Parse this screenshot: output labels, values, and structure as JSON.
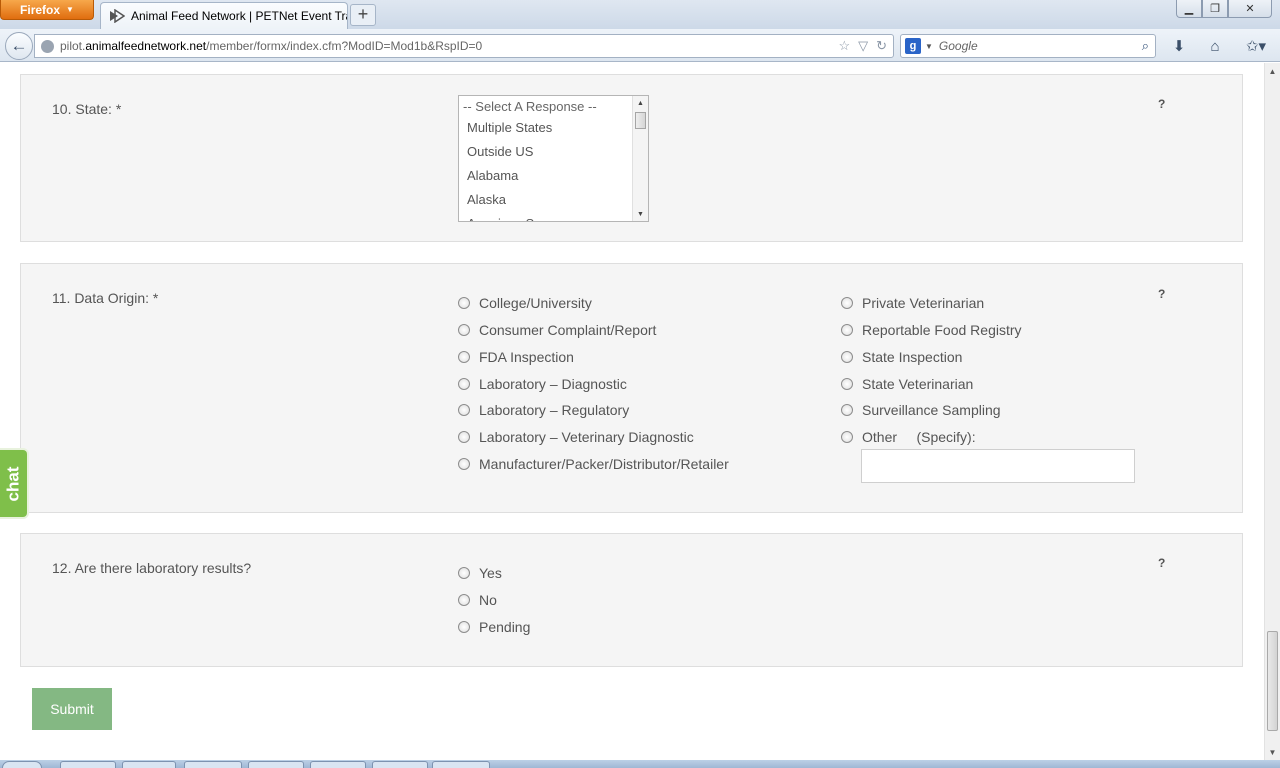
{
  "browser": {
    "app_button": "Firefox",
    "tab_title": "Animal Feed Network | PETNet Event Tra...",
    "url_prefix": "pilot.",
    "url_domain": "animalfeednetwork.net",
    "url_path": "/member/formx/index.cfm?ModID=Mod1b&RspID=0",
    "search_placeholder": "Google"
  },
  "form": {
    "q10": {
      "label": "10. State: *",
      "help": "?",
      "options": [
        "-- Select A Response --",
        "Multiple States",
        "Outside US",
        "Alabama",
        "Alaska",
        "American Samoa"
      ]
    },
    "q11": {
      "label": "11. Data Origin: *",
      "help": "?",
      "left_options": [
        "College/University",
        "Consumer Complaint/Report",
        "FDA Inspection",
        "Laboratory – Diagnostic",
        "Laboratory – Regulatory",
        "Laboratory – Veterinary Diagnostic",
        "Manufacturer/Packer/Distributor/Retailer"
      ],
      "right_options": [
        "Private Veterinarian",
        "Reportable Food Registry",
        "State Inspection",
        "State Veterinarian",
        "Surveillance Sampling",
        "Other     (Specify):"
      ],
      "other_value": ""
    },
    "q12": {
      "label": "12. Are there laboratory results?",
      "help": "?",
      "options": [
        "Yes",
        "No",
        "Pending"
      ]
    },
    "submit_label": "Submit"
  },
  "chat_widget": {
    "label": "chat"
  }
}
